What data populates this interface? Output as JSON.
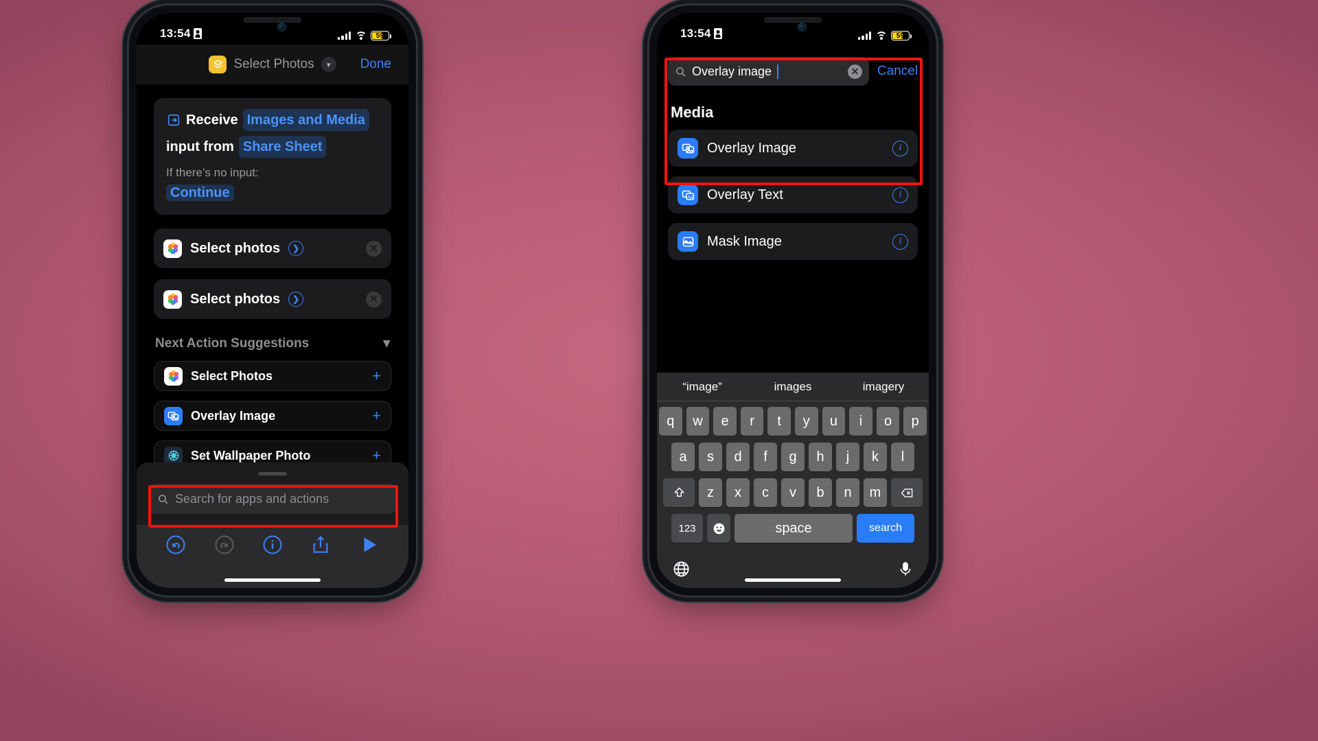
{
  "left_phone": {
    "status": {
      "time": "13:54",
      "icon": "lock-portrait-icon",
      "battery": "59"
    },
    "nav": {
      "title": "Select Photos",
      "app_icon": "shortcuts-icon",
      "chevron": "chevron-down-icon",
      "done_label": "Done"
    },
    "receive_card": {
      "icon": "receive-input-icon",
      "word1": "Receive",
      "token1": "Images and Media",
      "word2": "input from",
      "token2": "Share Sheet",
      "subtitle": "If there’s no input:",
      "token3": "Continue"
    },
    "actions": [
      {
        "icon": "photos-icon",
        "label": "Select photos",
        "arrow": "chevron-right-circle-icon",
        "remove": "remove-icon"
      },
      {
        "icon": "photos-icon",
        "label": "Select photos",
        "arrow": "chevron-right-circle-icon",
        "remove": "remove-icon"
      }
    ],
    "suggestions_header": {
      "label": "Next Action Suggestions",
      "chevron": "chevron-down-icon"
    },
    "suggestions": [
      {
        "icon": "photos-icon",
        "label": "Select Photos",
        "add": "plus-icon"
      },
      {
        "icon": "overlay-image-icon",
        "label": "Overlay Image",
        "add": "plus-icon"
      },
      {
        "icon": "set-wallpaper-icon",
        "label": "Set Wallpaper Photo",
        "add": "plus-icon"
      }
    ],
    "search": {
      "icon": "search-icon",
      "placeholder": "Search for apps and actions"
    },
    "toolbar": [
      {
        "name": "undo-icon"
      },
      {
        "name": "redo-icon"
      },
      {
        "name": "info-icon"
      },
      {
        "name": "share-icon"
      },
      {
        "name": "play-icon"
      }
    ]
  },
  "right_phone": {
    "status": {
      "time": "13:54",
      "icon": "lock-portrait-icon",
      "battery": "59"
    },
    "search": {
      "icon": "search-icon",
      "value": "Overlay image",
      "clear": "clear-icon"
    },
    "cancel_label": "Cancel",
    "section_header": "Media",
    "results": [
      {
        "icon": "overlay-image-icon",
        "label": "Overlay Image",
        "info": "info-icon"
      },
      {
        "icon": "overlay-text-icon",
        "label": "Overlay Text",
        "info": "info-icon"
      },
      {
        "icon": "mask-image-icon",
        "label": "Mask Image",
        "info": "info-icon"
      }
    ],
    "keyboard": {
      "suggestions": [
        "“image”",
        "images",
        "imagery"
      ],
      "row1": [
        "q",
        "w",
        "e",
        "r",
        "t",
        "y",
        "u",
        "i",
        "o",
        "p"
      ],
      "row2": [
        "a",
        "s",
        "d",
        "f",
        "g",
        "h",
        "j",
        "k",
        "l"
      ],
      "row3": [
        "z",
        "x",
        "c",
        "v",
        "b",
        "n",
        "m"
      ],
      "shift": "shift-icon",
      "backspace": "backspace-icon",
      "numbers_label": "123",
      "emoji": "emoji-icon",
      "space_label": "space",
      "search_label": "search",
      "globe": "globe-icon",
      "mic": "microphone-icon"
    }
  },
  "colors": {
    "accent": "#3b82f6",
    "highlight": "#f31212",
    "background": "#bb5f78",
    "battery": "#ffd60a"
  }
}
